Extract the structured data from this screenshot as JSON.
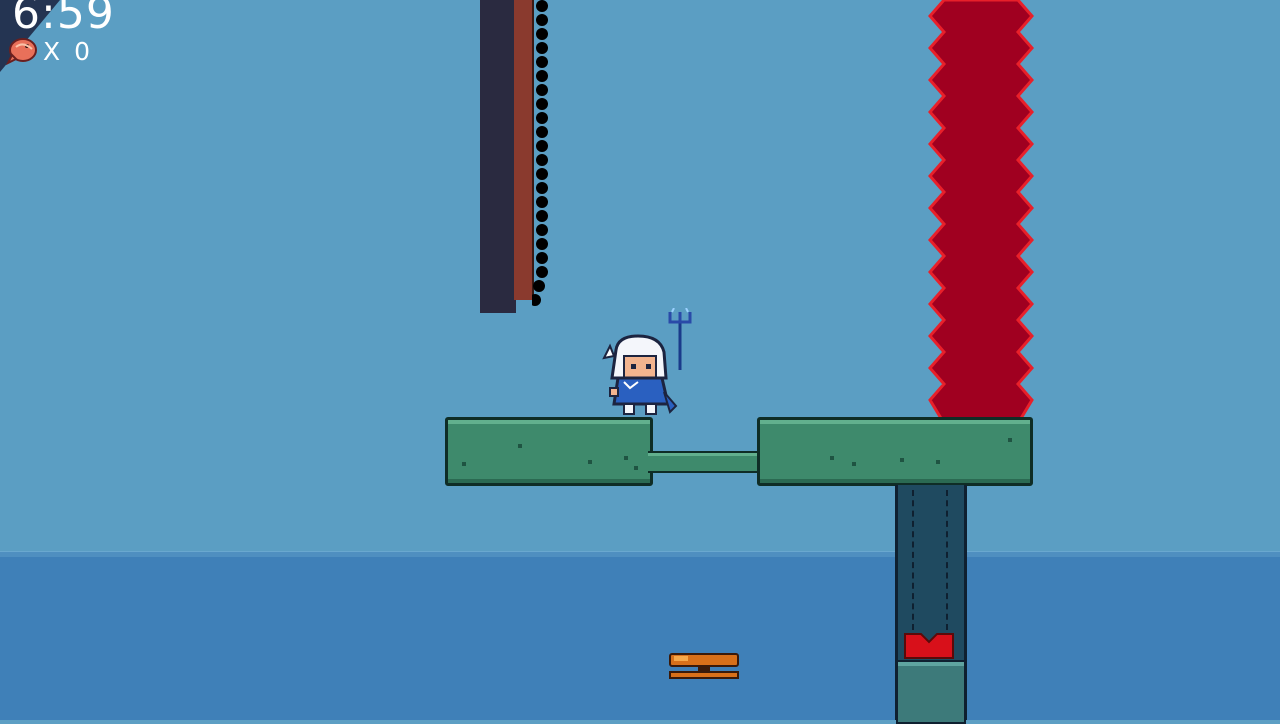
{
  "hud": {
    "timer": "6:59",
    "collectible_icon": "shrimp-icon",
    "collectible_count": "X 0"
  },
  "colors": {
    "sky": "#5b9ec3",
    "sea": "#3f80b8",
    "platform": "#3e8a6c",
    "saw_blade": "#a00020",
    "hud_corner": "#243452"
  }
}
